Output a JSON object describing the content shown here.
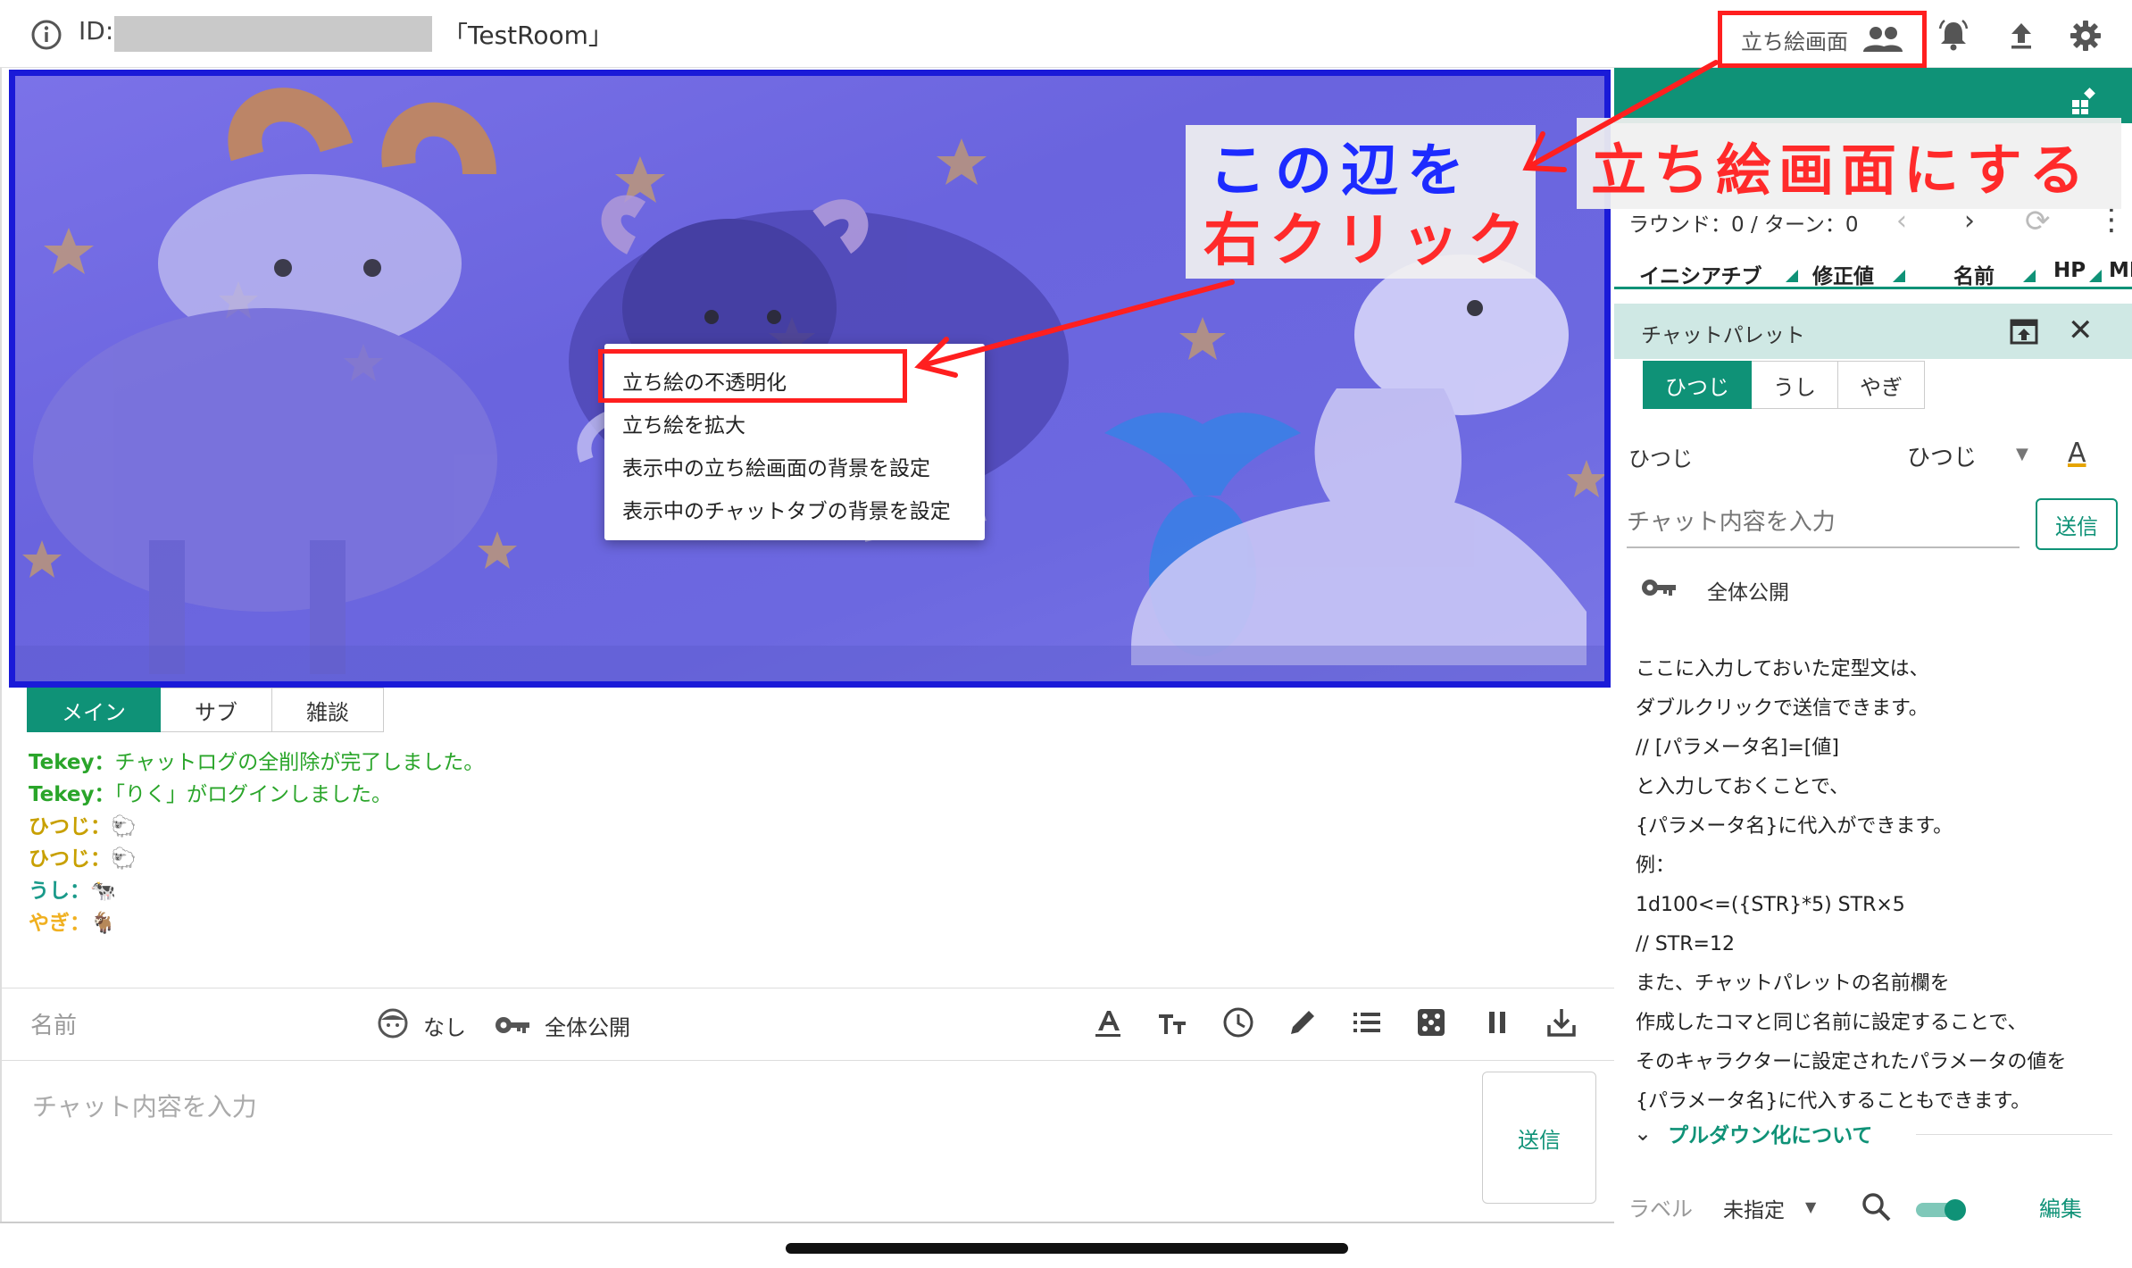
{
  "header": {
    "id_label": "ID:",
    "room_name": "「TestRoom」",
    "stand_button_label": "立ち絵画面"
  },
  "icons": {
    "info": "info-icon",
    "people": "people-icon",
    "bell": "bell-icon",
    "upload": "upload-icon",
    "gear": "gear-icon"
  },
  "context_menu": {
    "items": [
      "立ち絵の不透明化",
      "立ち絵を拡大",
      "表示中の立ち絵画面の背景を設定",
      "表示中のチャットタブの背景を設定"
    ]
  },
  "annotations": {
    "left_line1": "この辺を",
    "left_line2": "右クリック",
    "right": "立ち絵画面にする",
    "highlight_color": "#ff1f1f",
    "blue_text_color": "#1d2bff",
    "frame_color": "#1a1ad8"
  },
  "initiative": {
    "round_text": "ラウンド：0 / ターン：0",
    "columns": [
      "イニシアチブ",
      "修正値",
      "名前",
      "HP",
      "MP"
    ]
  },
  "palette": {
    "title": "チャットパレット",
    "tabs": [
      "ひつじ",
      "うし",
      "やぎ"
    ],
    "active_tab": 0,
    "character_label": "ひつじ",
    "character_select": "ひつじ",
    "color_icon": "A",
    "input_placeholder": "チャット内容を入力",
    "send_label": "送信",
    "visibility": "全体公開",
    "lines": [
      "ここに入力しておいた定型文は、",
      "ダブルクリックで送信できます。",
      "// [パラメータ名]=[値]",
      "と入力しておくことで、",
      "{パラメータ名}に代入ができます。",
      "例：",
      "1d100<=({STR}*5) STR×5",
      "// STR=12",
      "また、チャットパレットの名前欄を",
      "作成したコマと同じ名前に設定することで、",
      "そのキャラクターに設定されたパラメータの値を",
      "{パラメータ名}に代入することもできます。"
    ],
    "pulldown_label": "プルダウン化について",
    "footer_label": "ラベル",
    "footer_select": "未指定",
    "edit_label": "編集"
  },
  "chat": {
    "tabs": [
      "メイン",
      "サブ",
      "雑談"
    ],
    "active_tab": 0,
    "messages": [
      {
        "who": "Tekey：",
        "text": "チャットログの全削除が完了しました。",
        "color": "#2aa52a"
      },
      {
        "who": "Tekey：",
        "text": "「りく」がログインしました。",
        "color": "#2aa52a"
      },
      {
        "who": "ひつじ：",
        "text": "🐑",
        "color": "#c8a000"
      },
      {
        "who": "ひつじ：",
        "text": "🐑",
        "color": "#c8a000"
      },
      {
        "who": "うし：",
        "text": "🐄",
        "color": "#1a9a8a"
      },
      {
        "who": "やぎ：",
        "text": "🐐",
        "color": "#f0b020"
      }
    ],
    "name_placeholder": "名前",
    "face_label": "なし",
    "visibility": "全体公開",
    "input_placeholder": "チャット内容を入力",
    "send_label": "送信"
  },
  "colors": {
    "accent": "#0f9277"
  }
}
